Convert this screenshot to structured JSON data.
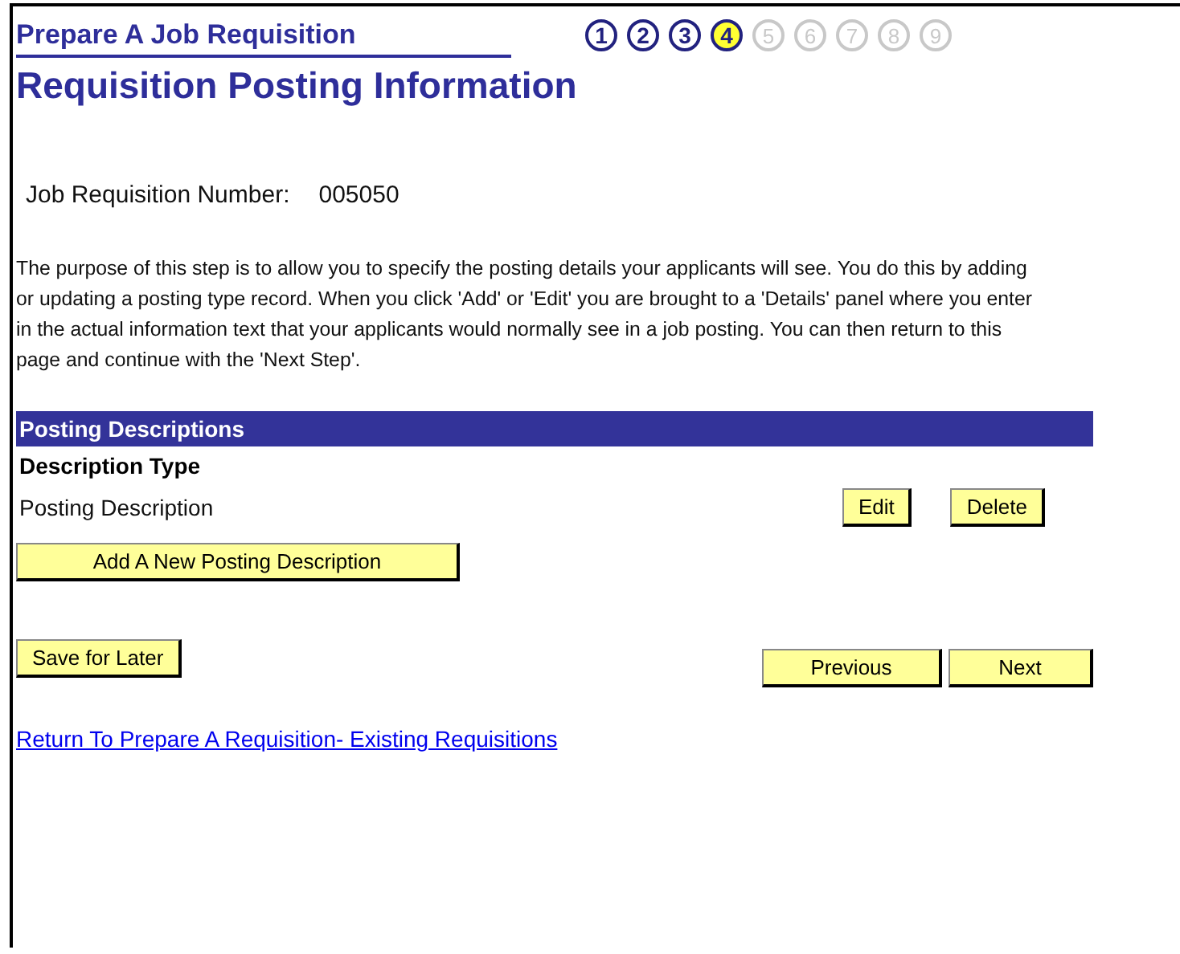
{
  "header": {
    "title": "Prepare A Job Requisition",
    "steps": [
      {
        "label": "1",
        "completed": true,
        "selected": false
      },
      {
        "label": "2",
        "completed": true,
        "selected": false
      },
      {
        "label": "3",
        "completed": true,
        "selected": false
      },
      {
        "label": "4",
        "completed": false,
        "selected": true
      },
      {
        "label": "5",
        "completed": false,
        "selected": false
      },
      {
        "label": "6",
        "completed": false,
        "selected": false
      },
      {
        "label": "7",
        "completed": false,
        "selected": false
      },
      {
        "label": "8",
        "completed": false,
        "selected": false
      },
      {
        "label": "9",
        "completed": false,
        "selected": false
      }
    ]
  },
  "heading": "Requisition Posting Information",
  "requisition": {
    "label": "Job Requisition Number:",
    "value": "005050"
  },
  "intro": "The purpose of this step is to allow you to specify the posting details your applicants will see. You do this by adding or updating a posting type record. When you click 'Add' or 'Edit' you are brought to a 'Details' panel where you enter in the actual information text that your applicants would normally see in a job posting. You can then return to this page and continue with the 'Next Step'.",
  "section": {
    "title": "Posting Descriptions",
    "column": "Description Type",
    "rows": [
      {
        "type": "Posting Description",
        "buttons": [
          "Edit",
          "Delete"
        ]
      }
    ],
    "add_button": "Add A New Posting Description"
  },
  "save_button": "Save for Later",
  "nav_buttons": [
    "Previous",
    "Next"
  ],
  "link": "Return To Prepare A Requisition- Existing Requisitions"
}
